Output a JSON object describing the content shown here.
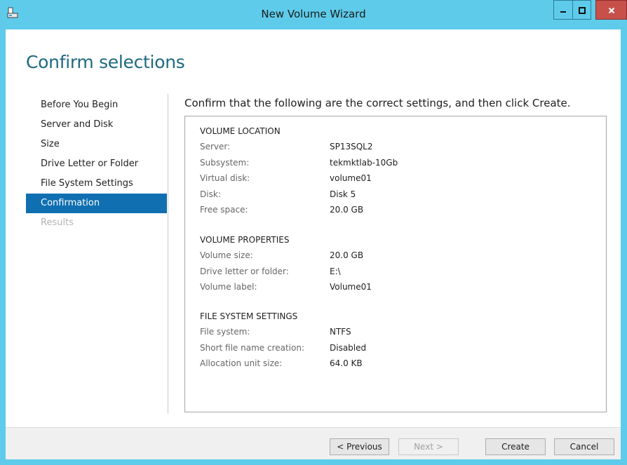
{
  "window": {
    "title": "New Volume Wizard",
    "icons": {
      "app": "volume-wizard-icon",
      "minimize": "minimize-icon",
      "maximize": "maximize-icon",
      "close": "close-icon"
    }
  },
  "page": {
    "heading": "Confirm selections",
    "instruction": "Confirm that the following are the correct settings, and then click Create."
  },
  "nav": {
    "items": [
      {
        "label": "Before You Begin",
        "state": "normal"
      },
      {
        "label": "Server and Disk",
        "state": "normal"
      },
      {
        "label": "Size",
        "state": "normal"
      },
      {
        "label": "Drive Letter or Folder",
        "state": "normal"
      },
      {
        "label": "File System Settings",
        "state": "normal"
      },
      {
        "label": "Confirmation",
        "state": "active"
      },
      {
        "label": "Results",
        "state": "disabled"
      }
    ]
  },
  "summary": {
    "volume_location": {
      "title": "VOLUME LOCATION",
      "rows": [
        {
          "key": "Server:",
          "value": "SP13SQL2"
        },
        {
          "key": "Subsystem:",
          "value": "tekmktlab-10Gb"
        },
        {
          "key": "Virtual disk:",
          "value": "volume01"
        },
        {
          "key": "Disk:",
          "value": "Disk 5"
        },
        {
          "key": "Free space:",
          "value": "20.0 GB"
        }
      ]
    },
    "volume_properties": {
      "title": "VOLUME PROPERTIES",
      "rows": [
        {
          "key": "Volume size:",
          "value": "20.0 GB"
        },
        {
          "key": "Drive letter or folder:",
          "value": "E:\\"
        },
        {
          "key": "Volume label:",
          "value": "Volume01"
        }
      ]
    },
    "file_system_settings": {
      "title": "FILE SYSTEM SETTINGS",
      "rows": [
        {
          "key": "File system:",
          "value": "NTFS"
        },
        {
          "key": "Short file name creation:",
          "value": "Disabled"
        },
        {
          "key": "Allocation unit size:",
          "value": "64.0 KB"
        }
      ]
    }
  },
  "buttons": {
    "previous": "< Previous",
    "next": "Next >",
    "create": "Create",
    "cancel": "Cancel"
  },
  "colors": {
    "title_bar": "#5ecbea",
    "heading": "#1d6a80",
    "nav_active": "#0f6fb1",
    "close_button": "#c7504b"
  }
}
